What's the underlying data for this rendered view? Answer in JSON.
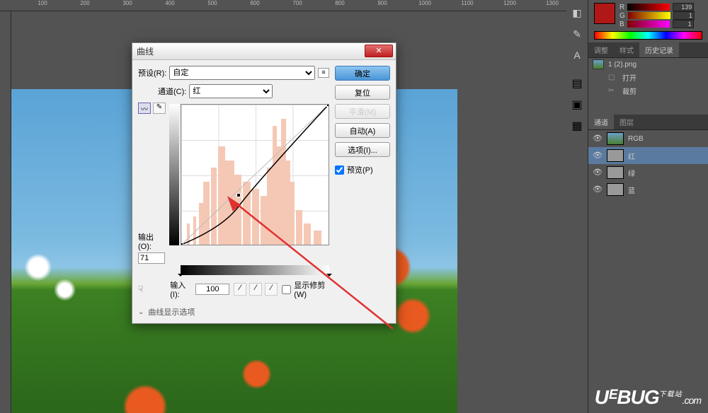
{
  "ruler": {
    "ticks": [
      "100",
      "200",
      "300",
      "400",
      "500",
      "600",
      "700",
      "800",
      "900",
      "1000",
      "1100",
      "1200",
      "1300"
    ]
  },
  "dialog": {
    "title": "曲线",
    "preset_label": "预设(R):",
    "preset_value": "自定",
    "channel_label": "通道(C):",
    "channel_value": "红",
    "output_label": "输出(O):",
    "output_value": "71",
    "input_label": "输入(I):",
    "input_value": "100",
    "show_clipping_label": "显示修剪(W)",
    "display_options_label": "曲线显示选项",
    "buttons": {
      "ok": "确定",
      "reset": "复位",
      "smooth": "平滑(M)",
      "auto": "自动(A)",
      "options": "选项(I)..."
    },
    "preview_label": "预览(P)"
  },
  "color": {
    "r_label": "R",
    "r_value": "139",
    "g_label": "G",
    "g_value": "1",
    "b_label": "B",
    "b_value": "1"
  },
  "panel_tabs": {
    "adjust": "调整",
    "style": "样式",
    "history": "历史记录"
  },
  "history": {
    "doc_name": "1 (2).png",
    "items": [
      "打开",
      "裁剪"
    ]
  },
  "channels": {
    "tab1": "通道",
    "tab2": "图层",
    "items": [
      "RGB",
      "红",
      "绿",
      "蓝"
    ]
  },
  "watermark": {
    "brand": "UᴱBUG",
    "sub": "下载站",
    "dot": ".com"
  },
  "chart_data": {
    "type": "line",
    "title": "曲线 (Curves Adjustment)",
    "channel": "红",
    "x_range": [
      0,
      255
    ],
    "y_range": [
      0,
      255
    ],
    "points": [
      {
        "input": 0,
        "output": 0
      },
      {
        "input": 100,
        "output": 71
      },
      {
        "input": 255,
        "output": 255
      }
    ],
    "current_point": {
      "input": 100,
      "output": 71
    }
  }
}
